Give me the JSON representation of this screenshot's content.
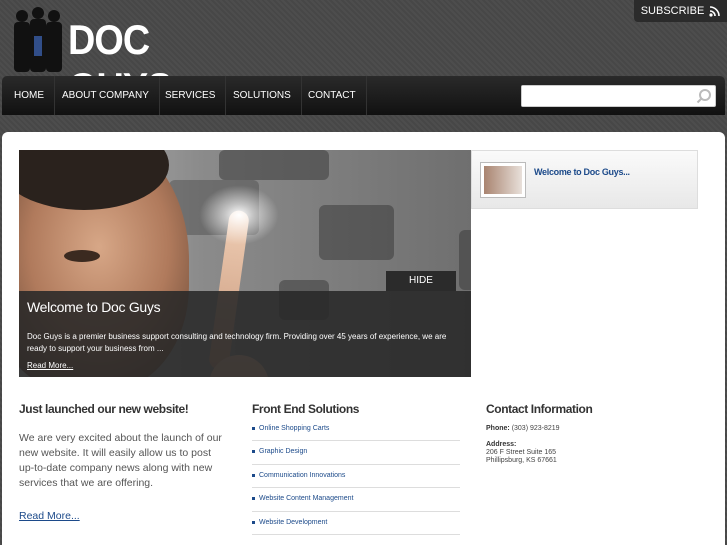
{
  "header": {
    "logo_text": "DOC GUYS",
    "subscribe_label": "SUBSCRIBE"
  },
  "nav": {
    "items": [
      {
        "label": "HOME"
      },
      {
        "label": "ABOUT COMPANY"
      },
      {
        "label": "SERVICES"
      },
      {
        "label": "SOLUTIONS"
      },
      {
        "label": "CONTACT"
      }
    ]
  },
  "search": {
    "value": "",
    "placeholder": ""
  },
  "slider": {
    "hide_label": "HIDE",
    "title": "Welcome to Doc Guys",
    "text": "Doc Guys is a premier business support consulting and technology firm. Providing over 45 years of experience, we are ready to support your business from ...",
    "read_more": "Read More...",
    "thumb_title": "Welcome to Doc Guys..."
  },
  "news": {
    "title": "Just launched our new website!",
    "text": "We are very excited about the launch of our new website. It will easily allow us to post up-to-date company news along with new services that we are offering.",
    "read_more": "Read More..."
  },
  "solutions": {
    "title": "Front End Solutions",
    "items": [
      "Online Shopping Carts",
      "Graphic Design",
      "Communication Innovations",
      "Website Content Management",
      "Website Development"
    ]
  },
  "contact": {
    "title": "Contact Information",
    "phone_label": "Phone:",
    "phone": "(303) 923-8219",
    "address_label": "Address:",
    "address_line1": "206 F Street Suite 165",
    "address_line2": "Phillipsburg, KS 67661"
  },
  "colors": {
    "link": "#1c4a8a",
    "nav_bg": "#1a1a1a",
    "page_bg": "#4a4a4a"
  }
}
